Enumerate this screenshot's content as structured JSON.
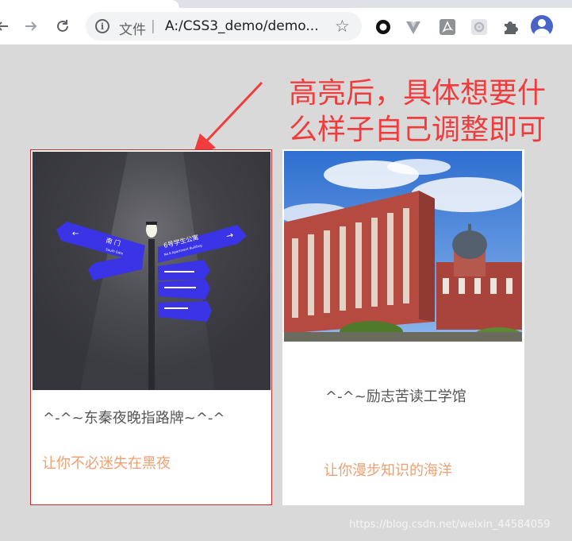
{
  "browser": {
    "back_icon": "back-arrow-icon",
    "forward_icon": "forward-arrow-icon",
    "reload_icon": "reload-icon",
    "address": {
      "security_label": "文件",
      "separator": "|",
      "url": "A:/CSS3_demo/demo..."
    },
    "extensions": [
      "record-icon",
      "vue-devtools-icon",
      "acrobat-icon",
      "settings-extension-icon",
      "puzzle-icon"
    ],
    "avatar": "profile-avatar"
  },
  "annotation": {
    "text_line1": "高亮后，具体想要什",
    "text_line2": "么样子自己调整即可",
    "color": "#f03c3c"
  },
  "cards": [
    {
      "title": "^-^~东秦夜晚指路牌~^-^",
      "subtitle": "让你不必迷失在黑夜",
      "highlighted": true,
      "highlight_color": "#d22a2a",
      "sign": {
        "south_gate": "南 门",
        "south_gate_en": "South Gate",
        "building": "6号学生公寓",
        "building_en": "No.6 Apartment Building"
      }
    },
    {
      "title": "^-^~励志苦读工学馆",
      "subtitle": "让你漫步知识的海洋",
      "highlighted": false
    }
  ],
  "colors": {
    "page_bg": "#d9d9d9",
    "title_text": "#555555",
    "subtitle_text": "#f0a070"
  },
  "watermark": "https://blog.csdn.net/weixin_44584059"
}
